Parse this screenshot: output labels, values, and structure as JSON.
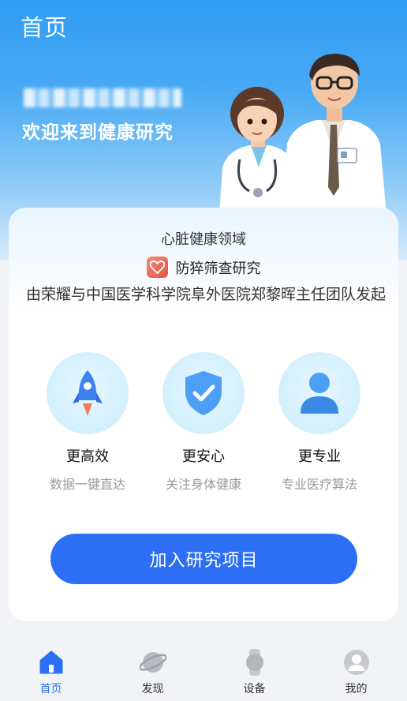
{
  "header": {
    "title": "首页",
    "welcome": "欢迎来到健康研究"
  },
  "card": {
    "domain": "心脏健康领域",
    "study_title": "防猝筛查研究",
    "initiator": "由荣耀与中国医学科学院阜外医院郑黎晖主任团队发起",
    "features": [
      {
        "title": "更高效",
        "subtitle": "数据一键直达",
        "icon": "rocket-icon"
      },
      {
        "title": "更安心",
        "subtitle": "关注身体健康",
        "icon": "shield-check-icon"
      },
      {
        "title": "更专业",
        "subtitle": "专业医疗算法",
        "icon": "person-icon"
      }
    ],
    "join_button": "加入研究项目"
  },
  "tabbar": {
    "items": [
      {
        "label": "首页",
        "icon": "home-icon",
        "active": true
      },
      {
        "label": "发现",
        "icon": "planet-icon",
        "active": false
      },
      {
        "label": "设备",
        "icon": "watch-icon",
        "active": false
      },
      {
        "label": "我的",
        "icon": "profile-icon",
        "active": false
      }
    ]
  },
  "colors": {
    "accent": "#2c6ff5",
    "hero_top": "#2f9cf3",
    "feature_circle": "#c8ecfb"
  }
}
